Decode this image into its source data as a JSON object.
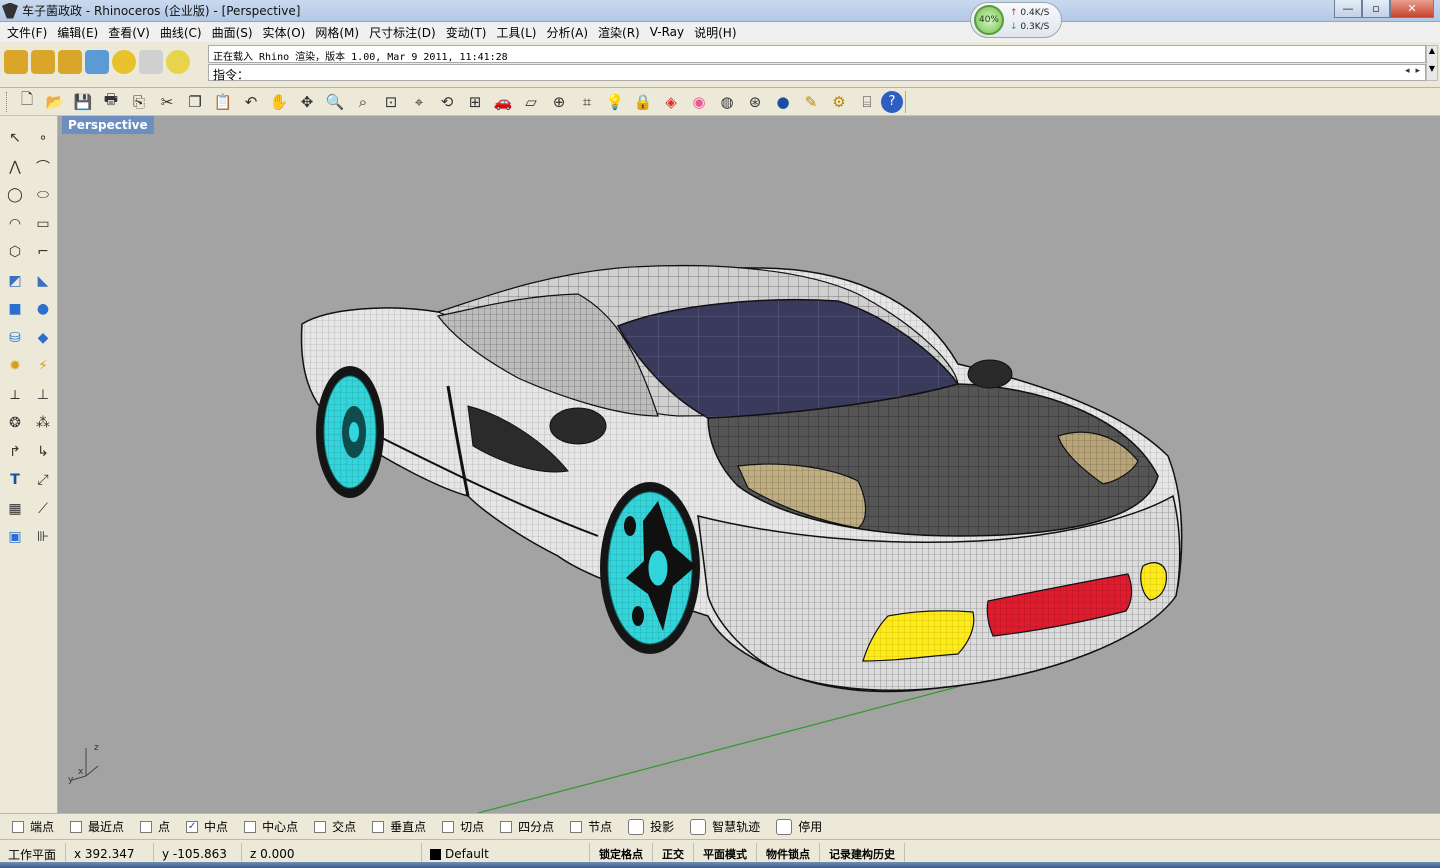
{
  "window": {
    "title": "车子菌政政 - Rhinoceros (企业版) - [Perspective]",
    "buttons": {
      "minimize": "—",
      "maximize": "▫",
      "close": "✕"
    }
  },
  "net_widget": {
    "cpu": "40%",
    "up": "0.4K/S",
    "down": "0.3K/S"
  },
  "menu": [
    "文件(F)",
    "编辑(E)",
    "查看(V)",
    "曲线(C)",
    "曲面(S)",
    "实体(O)",
    "网格(M)",
    "尺寸标注(D)",
    "变动(T)",
    "工具(L)",
    "分析(A)",
    "渲染(R)",
    "V-Ray",
    "说明(H)"
  ],
  "command": {
    "history": "正在载入 Rhino 渲染，版本 1.00, Mar  9 2011, 11:41:28",
    "prompt": "指令："
  },
  "top_icon_colors": [
    "#d9a62a",
    "#d9a62a",
    "#d9a62a",
    "#5b9bd5",
    "#e8c22a",
    "#d0d0d0",
    "#e8d44a"
  ],
  "std_toolbar": [
    "new-file",
    "open",
    "save",
    "print",
    "import",
    "cut",
    "copy",
    "paste",
    "undo",
    "pan",
    "rotate",
    "zoom-in",
    "zoom-window",
    "zoom-extents",
    "zoom-selected",
    "rotate-view",
    "four-views",
    "car",
    "plane",
    "target",
    "snap",
    "bulb",
    "lock",
    "layers",
    "color-wheel",
    "sphere-shade",
    "render-mesh",
    "render-ball",
    "pen",
    "gear",
    "grid-snap",
    "help"
  ],
  "viewport": {
    "tab": "Perspective",
    "axes": {
      "x": "x",
      "y": "y",
      "z": "z"
    },
    "colors": {
      "background": "#a3a3a3",
      "wheel": "#31d6dc",
      "lights": "#ffeb1a",
      "grille": "#e21a2d",
      "glass": "#3a3a5c",
      "body": "#e6e6e6",
      "grid_axis": "#2f9a2f"
    }
  },
  "osnaps": [
    {
      "label": "端点",
      "checked": false
    },
    {
      "label": "最近点",
      "checked": false
    },
    {
      "label": "点",
      "checked": false
    },
    {
      "label": "中点",
      "checked": true
    },
    {
      "label": "中心点",
      "checked": false
    },
    {
      "label": "交点",
      "checked": false
    },
    {
      "label": "垂直点",
      "checked": false
    },
    {
      "label": "切点",
      "checked": false
    },
    {
      "label": "四分点",
      "checked": false
    },
    {
      "label": "节点",
      "checked": false
    },
    {
      "label": "投影",
      "checked": false
    },
    {
      "label": "智慧轨迹",
      "checked": false
    },
    {
      "label": "停用",
      "checked": false
    }
  ],
  "status": {
    "plane": "工作平面",
    "x": "x 392.347",
    "y": "y -105.863",
    "z": "z 0.000",
    "layer": "Default",
    "buttons": [
      "锁定格点",
      "正交",
      "平面模式",
      "物件锁点",
      "记录建构历史"
    ]
  }
}
